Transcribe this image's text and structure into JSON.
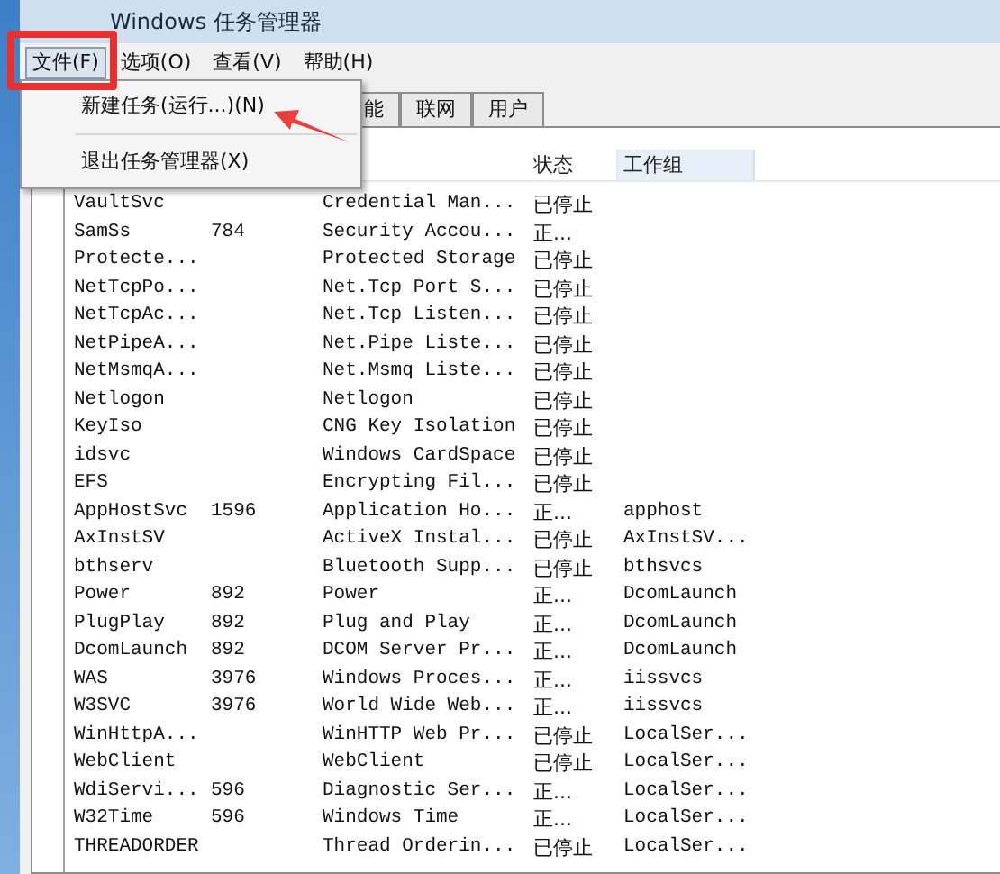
{
  "window": {
    "title": "Windows 任务管理器"
  },
  "menu_bar": [
    {
      "label": "文件(F)",
      "selected": true
    },
    {
      "label": "选项(O)",
      "selected": false
    },
    {
      "label": "查看(V)",
      "selected": false
    },
    {
      "label": "帮助(H)",
      "selected": false
    }
  ],
  "file_menu": {
    "items": [
      {
        "kind": "item",
        "label": "新建任务(运行...)(N)"
      },
      {
        "kind": "separator"
      },
      {
        "kind": "item",
        "label": "退出任务管理器(X)"
      }
    ]
  },
  "tabs": [
    {
      "label": "能",
      "selected": false
    },
    {
      "label": "联网",
      "selected": false
    },
    {
      "label": "用户",
      "selected": false
    }
  ],
  "table": {
    "columns": [
      "状态",
      "工作组"
    ],
    "rows": [
      {
        "name": "VaultSvc",
        "pid": "",
        "description": "Credential Man...",
        "status": "已停止",
        "group": ""
      },
      {
        "name": "SamSs",
        "pid": "784",
        "description": "Security Accou...",
        "status": "正...",
        "group": ""
      },
      {
        "name": "Protecte...",
        "pid": "",
        "description": "Protected Storage",
        "status": "已停止",
        "group": ""
      },
      {
        "name": "NetTcpPo...",
        "pid": "",
        "description": "Net.Tcp Port S...",
        "status": "已停止",
        "group": ""
      },
      {
        "name": "NetTcpAc...",
        "pid": "",
        "description": "Net.Tcp Listen...",
        "status": "已停止",
        "group": ""
      },
      {
        "name": "NetPipeA...",
        "pid": "",
        "description": "Net.Pipe Liste...",
        "status": "已停止",
        "group": ""
      },
      {
        "name": "NetMsmqA...",
        "pid": "",
        "description": "Net.Msmq Liste...",
        "status": "已停止",
        "group": ""
      },
      {
        "name": "Netlogon",
        "pid": "",
        "description": "Netlogon",
        "status": "已停止",
        "group": ""
      },
      {
        "name": "KeyIso",
        "pid": "",
        "description": "CNG Key Isolation",
        "status": "已停止",
        "group": ""
      },
      {
        "name": "idsvc",
        "pid": "",
        "description": "Windows CardSpace",
        "status": "已停止",
        "group": ""
      },
      {
        "name": "EFS",
        "pid": "",
        "description": "Encrypting Fil...",
        "status": "已停止",
        "group": ""
      },
      {
        "name": "AppHostSvc",
        "pid": "1596",
        "description": "Application Ho...",
        "status": "正...",
        "group": "apphost"
      },
      {
        "name": "AxInstSV",
        "pid": "",
        "description": "ActiveX Instal...",
        "status": "已停止",
        "group": "AxInstSV..."
      },
      {
        "name": "bthserv",
        "pid": "",
        "description": "Bluetooth Supp...",
        "status": "已停止",
        "group": "bthsvcs"
      },
      {
        "name": "Power",
        "pid": "892",
        "description": "Power",
        "status": "正...",
        "group": "DcomLaunch"
      },
      {
        "name": "PlugPlay",
        "pid": "892",
        "description": "Plug and Play",
        "status": "正...",
        "group": "DcomLaunch"
      },
      {
        "name": "DcomLaunch",
        "pid": "892",
        "description": "DCOM Server Pr...",
        "status": "正...",
        "group": "DcomLaunch"
      },
      {
        "name": "WAS",
        "pid": "3976",
        "description": "Windows Proces...",
        "status": "正...",
        "group": "iissvcs"
      },
      {
        "name": "W3SVC",
        "pid": "3976",
        "description": "World Wide Web...",
        "status": "正...",
        "group": "iissvcs"
      },
      {
        "name": "WinHttpA...",
        "pid": "",
        "description": "WinHTTP Web Pr...",
        "status": "已停止",
        "group": "LocalSer..."
      },
      {
        "name": "WebClient",
        "pid": "",
        "description": "WebClient",
        "status": "已停止",
        "group": "LocalSer..."
      },
      {
        "name": "WdiServi...",
        "pid": "596",
        "description": "Diagnostic Ser...",
        "status": "正...",
        "group": "LocalSer..."
      },
      {
        "name": "W32Time",
        "pid": "596",
        "description": "Windows Time",
        "status": "正...",
        "group": "LocalSer..."
      },
      {
        "name": "THREADORDER",
        "pid": "",
        "description": "Thread Orderin...",
        "status": "已停止",
        "group": "LocalSer..."
      }
    ]
  }
}
